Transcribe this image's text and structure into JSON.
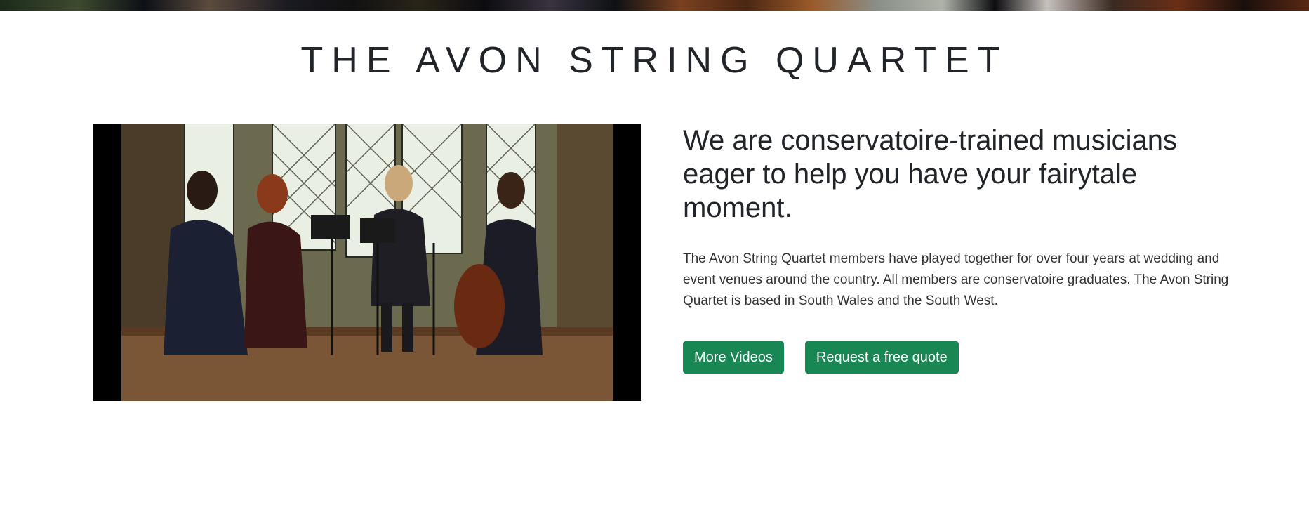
{
  "header": {
    "title": "THE AVON STRING QUARTET"
  },
  "video": {
    "icon": "video-thumbnail"
  },
  "intro": {
    "headline": "We are conservatoire-trained musicians eager to help you have your fairytale moment.",
    "body": "The Avon String Quartet members have played together for over four years at wedding and event venues around the country. All members are conservatoire graduates. The Avon String Quartet is based in South Wales and the South West."
  },
  "actions": {
    "more_videos_label": "More Videos",
    "quote_label": "Request a free quote"
  },
  "colors": {
    "button": "#198754",
    "text": "#212529"
  }
}
